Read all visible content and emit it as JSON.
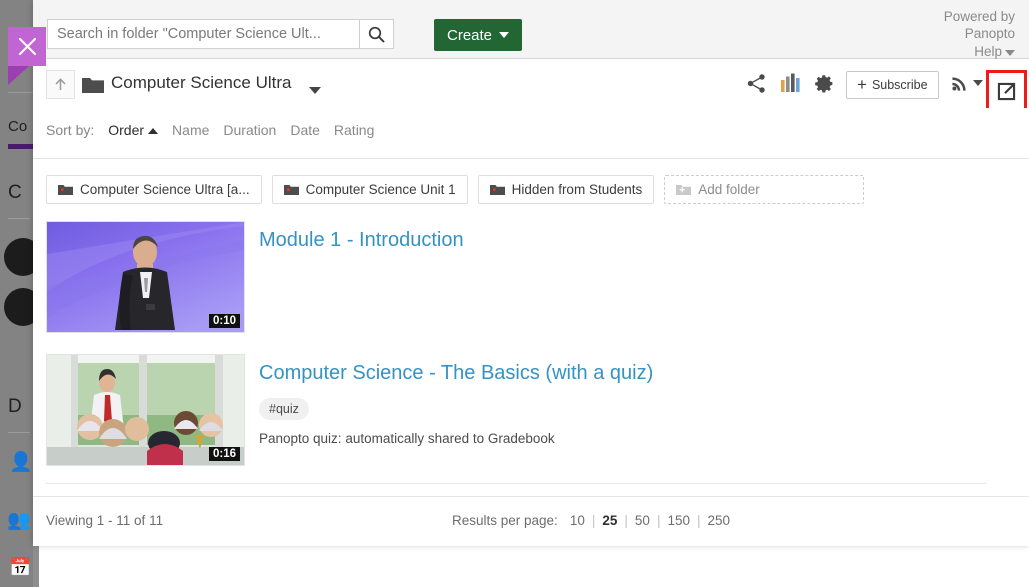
{
  "background": {
    "sidebar_labels": [
      "Co",
      "C",
      "D"
    ],
    "icons": [
      "profile-icon",
      "group-icon",
      "calendar-icon"
    ]
  },
  "close_button": {
    "icon": "close-icon",
    "label": "Close"
  },
  "topbar": {
    "search": {
      "placeholder": "Search in folder \"Computer Science Ult...",
      "value": "",
      "icon": "search-icon"
    },
    "create_label": "Create",
    "powered_by_line1": "Powered by",
    "powered_by_line2": "Panopto",
    "help_label": "Help"
  },
  "folder_header": {
    "up_icon": "arrow-up-icon",
    "folder_icon": "folder-icon",
    "title": "Computer Science Ultra",
    "caret_icon": "chevron-down-icon",
    "tools": [
      {
        "name": "share-icon",
        "label": "Share"
      },
      {
        "name": "stats-icon",
        "label": "Stats"
      },
      {
        "name": "settings-gear-icon",
        "label": "Settings"
      }
    ],
    "subscribe_label": "Subscribe",
    "rss_label": "RSS",
    "open_new_window_label": "Open in new window"
  },
  "sortbar": {
    "label": "Sort by:",
    "items": [
      {
        "label": "Order",
        "active": true,
        "direction": "asc"
      },
      {
        "label": "Name",
        "active": false
      },
      {
        "label": "Duration",
        "active": false
      },
      {
        "label": "Date",
        "active": false
      },
      {
        "label": "Rating",
        "active": false
      }
    ]
  },
  "folders": [
    {
      "label": "Computer Science Ultra [a...",
      "icon": "folder-icon"
    },
    {
      "label": "Computer Science Unit 1",
      "icon": "folder-icon"
    },
    {
      "label": "Hidden from Students",
      "icon": "folder-icon"
    },
    {
      "label": "Add folder",
      "icon": "add-folder-icon",
      "is_add": true
    }
  ],
  "videos": [
    {
      "title": "Module 1 - Introduction",
      "duration": "0:10",
      "tag": "",
      "description": ""
    },
    {
      "title": "Computer Science - The Basics (with a quiz)",
      "duration": "0:16",
      "tag": "#quiz",
      "description": "Panopto quiz: automatically shared to Gradebook"
    }
  ],
  "footer": {
    "viewing": "Viewing 1 - 11 of 11",
    "results_per_page_label": "Results per page:",
    "options": [
      "10",
      "25",
      "50",
      "150",
      "250"
    ],
    "selected": "25"
  },
  "colors": {
    "accent_green": "#226633",
    "link_blue": "#3592c4",
    "highlight_red": "#ee1b1b",
    "close_purple": "#c065d2",
    "close_tail_purple": "#9c3fb0"
  }
}
